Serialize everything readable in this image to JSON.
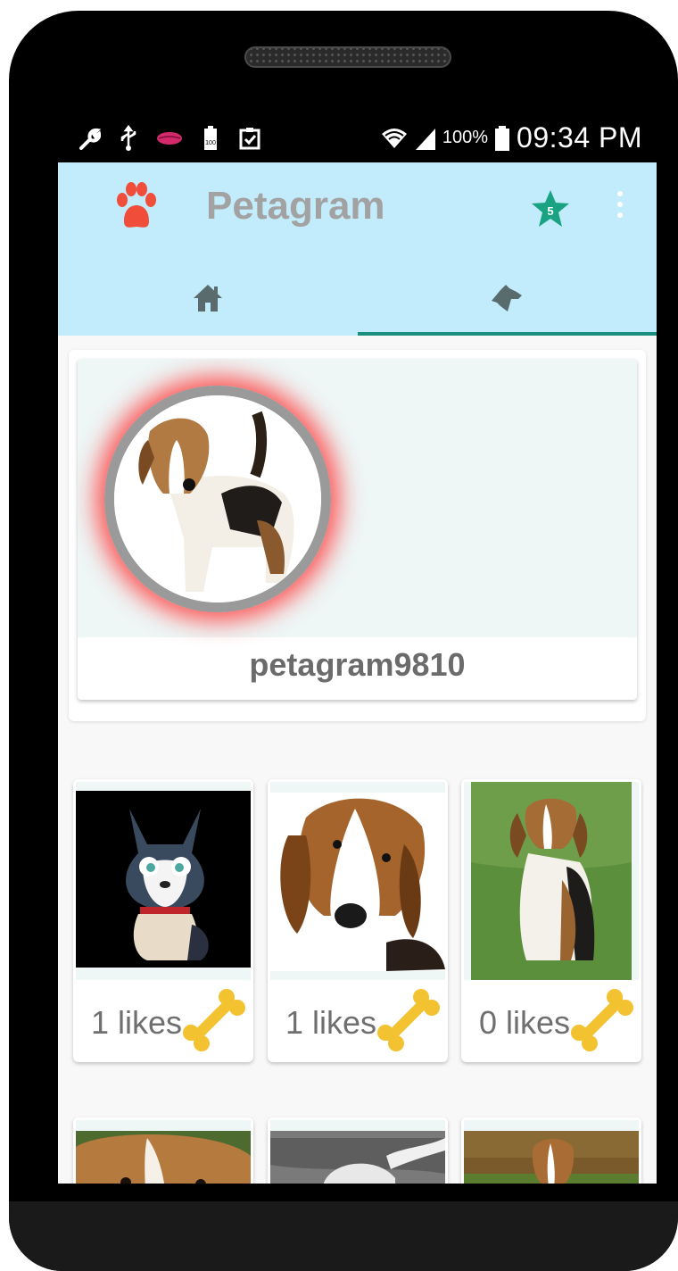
{
  "status_bar": {
    "battery_percent": "100%",
    "time": "09:34 PM",
    "icons": [
      "wrench-icon",
      "usb-icon",
      "lips-icon",
      "battery-100-icon",
      "clipboard-check-icon",
      "wifi-icon",
      "signal-icon",
      "battery-icon"
    ]
  },
  "app_bar": {
    "title": "Petagram",
    "logo_icon": "paw-icon",
    "star_badge": "5",
    "overflow_icon": "more-vert-icon"
  },
  "tabs": [
    {
      "icon": "home-icon",
      "selected": false
    },
    {
      "icon": "dog-icon",
      "selected": true
    }
  ],
  "profile": {
    "username": "petagram9810"
  },
  "pets": [
    {
      "likes": "1 likes"
    },
    {
      "likes": "1 likes"
    },
    {
      "likes": "0 likes"
    }
  ],
  "colors": {
    "app_bar": "#c2ecfb",
    "tab_indicator": "#1a8f7e",
    "paw": "#f04d3a",
    "star": "#1aa383",
    "bone": "#f2c230"
  }
}
